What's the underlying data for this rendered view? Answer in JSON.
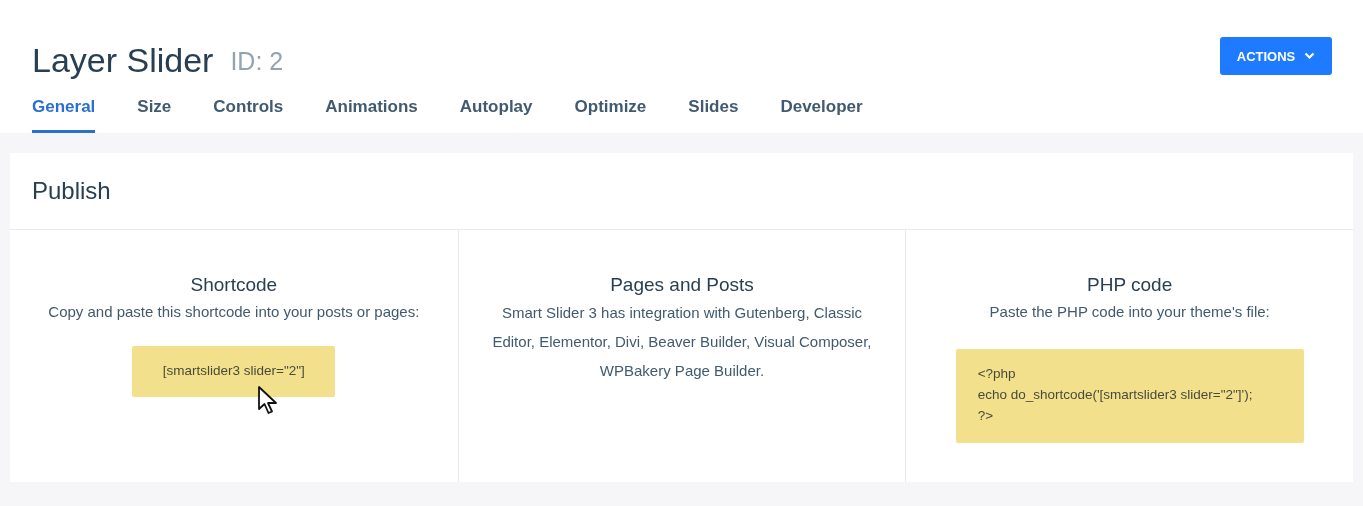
{
  "header": {
    "title": "Layer Slider",
    "id_label": "ID: 2",
    "actions_button": "ACTIONS"
  },
  "tabs": [
    {
      "label": "General",
      "selected": true
    },
    {
      "label": "Size",
      "selected": false
    },
    {
      "label": "Controls",
      "selected": false
    },
    {
      "label": "Animations",
      "selected": false
    },
    {
      "label": "Autoplay",
      "selected": false
    },
    {
      "label": "Optimize",
      "selected": false
    },
    {
      "label": "Slides",
      "selected": false
    },
    {
      "label": "Developer",
      "selected": false
    }
  ],
  "publish": {
    "title": "Publish",
    "columns": [
      {
        "kind": "code",
        "heading": "Shortcode",
        "description": "Copy and paste this shortcode into your posts or pages:",
        "code_lines": [
          "[smartslider3 slider=\"2\"]"
        ]
      },
      {
        "kind": "text",
        "heading": "Pages and Posts",
        "description": "Smart Slider 3 has integration with Gutenberg, Classic Editor, Elementor, Divi, Beaver Builder, Visual Composer, WPBakery Page Builder."
      },
      {
        "kind": "code",
        "heading": "PHP code",
        "description": "Paste the PHP code into your theme's file:",
        "code_lines": [
          "<?php",
          "echo do_shortcode('[smartslider3 slider=\"2\"]');",
          "?>"
        ]
      }
    ]
  }
}
